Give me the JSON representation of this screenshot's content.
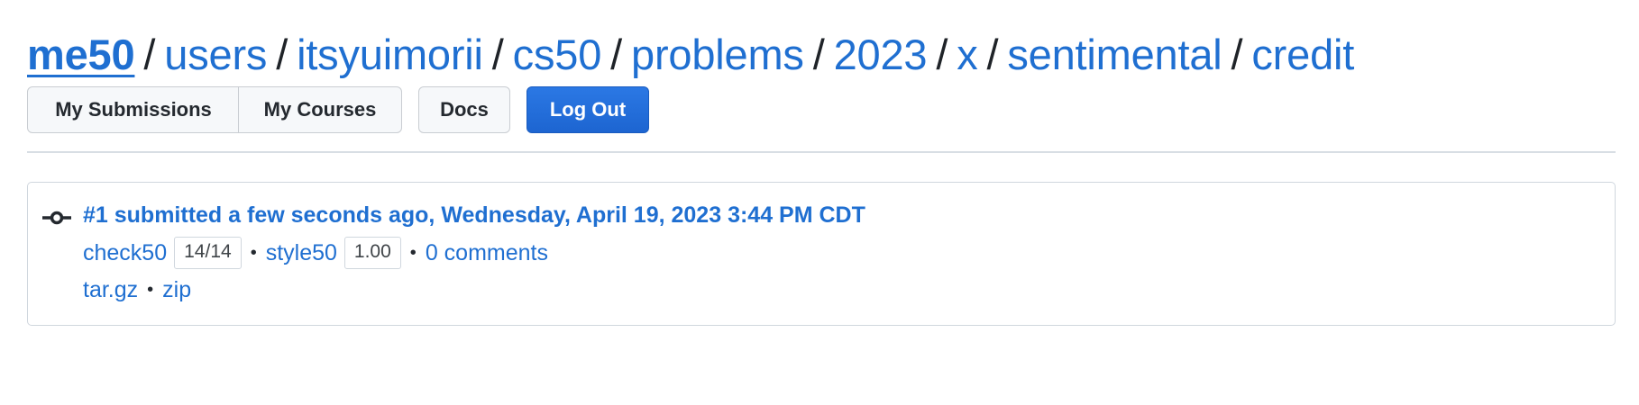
{
  "breadcrumb": {
    "items": [
      "me50",
      "users",
      "itsyuimorii",
      "cs50",
      "problems",
      "2023",
      "x",
      "sentimental",
      "credit"
    ],
    "separator": "/"
  },
  "nav": {
    "my_submissions": "My Submissions",
    "my_courses": "My Courses",
    "docs": "Docs",
    "log_out": "Log Out"
  },
  "submission": {
    "title": "#1 submitted a few seconds ago, Wednesday, April 19, 2023 3:44 PM CDT",
    "check50_label": "check50",
    "check50_score": "14/14",
    "style50_label": "style50",
    "style50_score": "1.00",
    "comments": "0 comments",
    "download_targz": "tar.gz",
    "download_zip": "zip",
    "separator": "•",
    "icon": "git-commit-icon"
  },
  "colors": {
    "link": "#1f6fd1",
    "primary_button": "#1f6fe0",
    "border": "#d0d7de"
  }
}
